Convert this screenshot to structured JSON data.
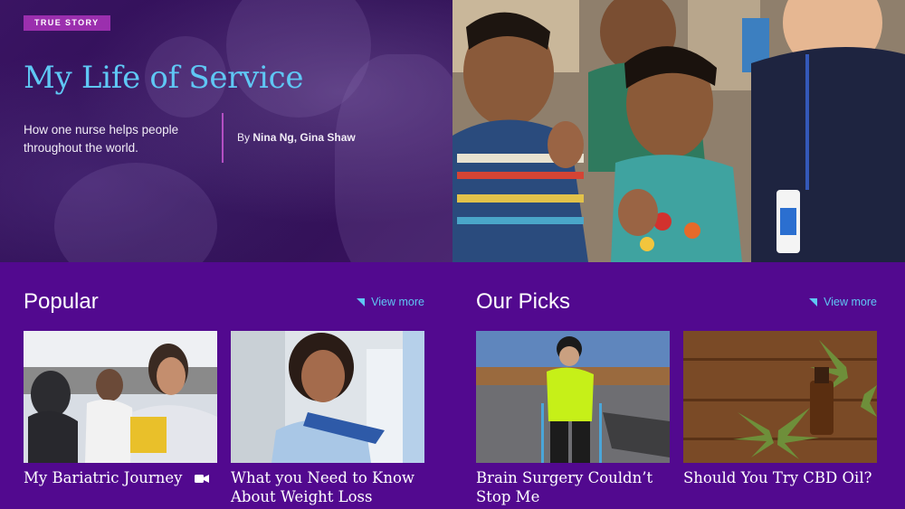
{
  "hero": {
    "badge": "TRUE STORY",
    "title": "My Life of Service",
    "subtitle": "How one nurse helps people throughout the world.",
    "byline_prefix": "By",
    "byline_authors": "Nina Ng, Gina Shaw"
  },
  "sections": [
    {
      "title": "Popular",
      "view_more": "View more",
      "cards": [
        {
          "title": "My Bariatric Journey",
          "has_video": true,
          "icon": "video-camera-icon"
        },
        {
          "title": "What you Need to Know About Weight Loss Surgery",
          "has_video": false
        }
      ]
    },
    {
      "title": "Our Picks",
      "view_more": "View more",
      "cards": [
        {
          "title": "Brain Surgery Couldn’t Stop Me",
          "has_video": false
        },
        {
          "title": "Should You Try CBD Oil?",
          "has_video": false
        }
      ]
    }
  ],
  "colors": {
    "background": "#52098f",
    "accent": "#5fc7f4",
    "badge": "#9b2fae",
    "divider": "#b44fc3"
  }
}
